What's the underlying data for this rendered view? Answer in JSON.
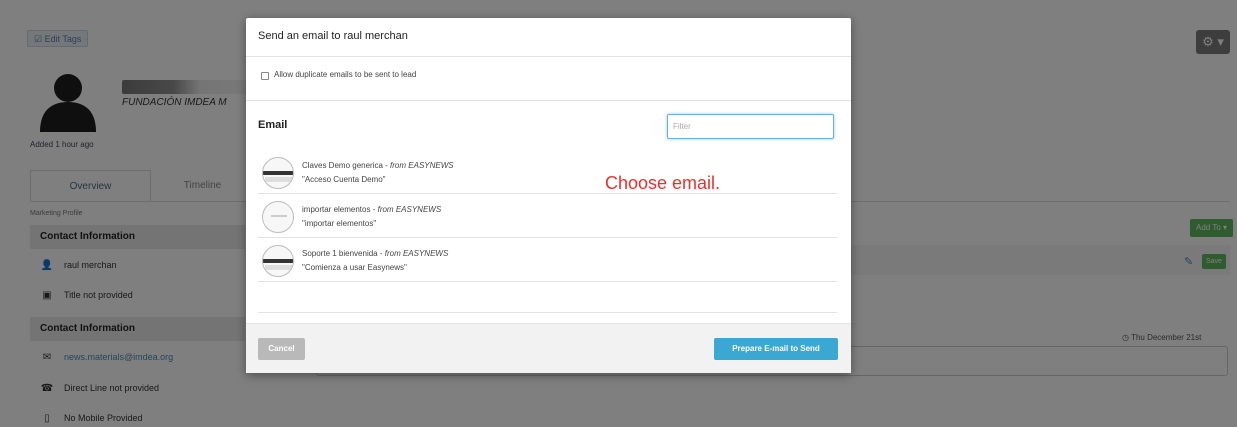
{
  "background": {
    "edit_tags_label": "☑ Edit Tags",
    "gear_label": "⚙ ▾",
    "company": "FUNDACIÓN IMDEA M",
    "added_ago": "Added 1 hour ago",
    "tabs": [
      {
        "label": "Overview"
      },
      {
        "label": "Timeline"
      }
    ],
    "marketing_profile": "Marketing Profile",
    "section1_title": "Contact Information",
    "contact_name": "raul merchan",
    "title_not_provided": "Title not provided",
    "section2_title": "Contact Information",
    "email": "news.materials@imdea.org",
    "direct_line": "Direct Line not provided",
    "mobile": "No Mobile Provided",
    "add_to_label": "Add To ▾",
    "save_label": "Save",
    "date_label": "Thu December 21st"
  },
  "modal": {
    "title": "Send an email to raul merchan",
    "duplicate_label": "Allow duplicate emails to be sent to lead",
    "email_heading": "Email",
    "filter_placeholder": "Filter",
    "items": [
      {
        "name": "Claves Demo generica - ",
        "from": "from EASYNEWS",
        "subject": "\"Acceso Cuenta Demo\""
      },
      {
        "name": "importar elementos - ",
        "from": "from EASYNEWS",
        "subject": "\"importar elementos\""
      },
      {
        "name": "Soporte 1 bienvenida - ",
        "from": "from EASYNEWS",
        "subject": "\"Comienza a usar Easynews\""
      }
    ],
    "annotation": "Choose email.",
    "cancel_label": "Cancel",
    "send_label": "Prepare E-mail to Send"
  },
  "colors": {
    "primary": "#3aa8d3",
    "success": "#5cb85c",
    "annotation": "#e8312f"
  }
}
